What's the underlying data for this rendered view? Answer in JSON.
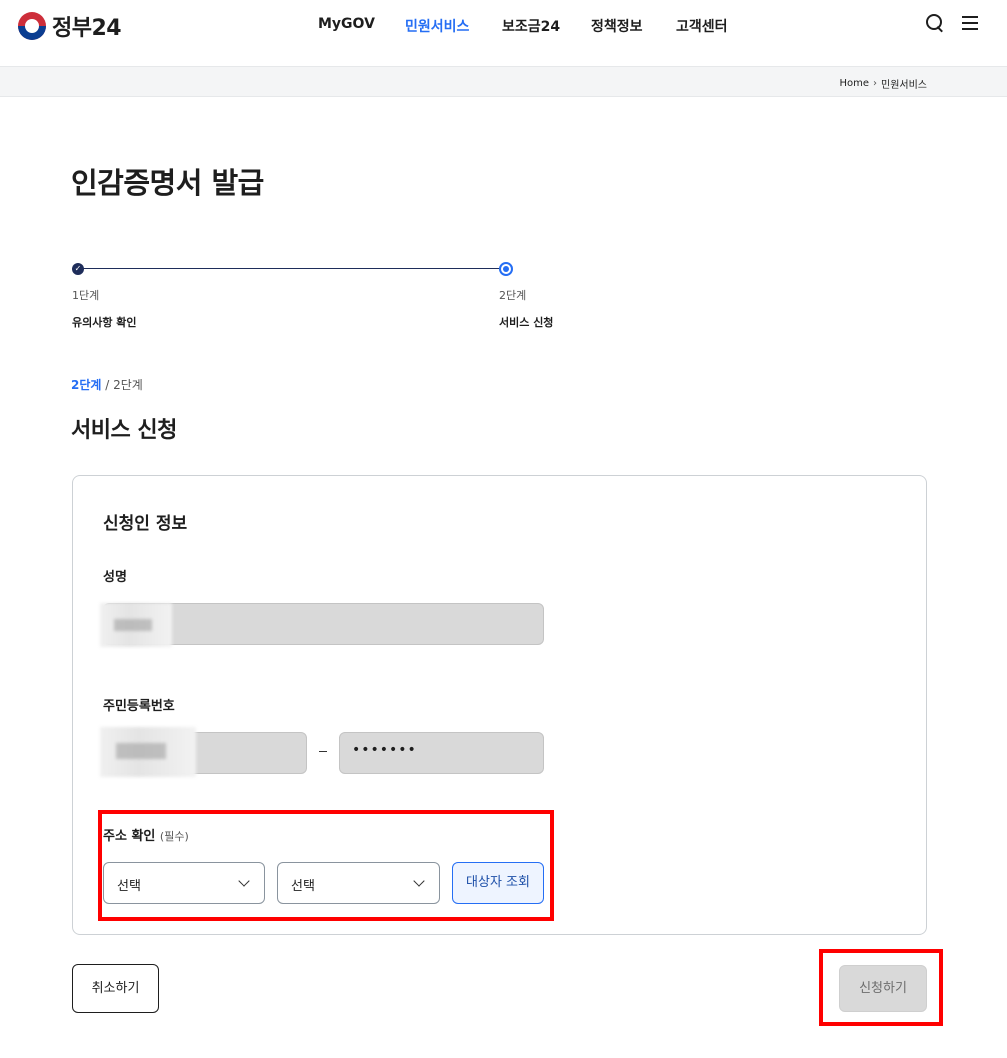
{
  "header": {
    "logo_text": "정부24",
    "nav": [
      {
        "label": "MyGOV",
        "active": false
      },
      {
        "label": "민원서비스",
        "active": true
      },
      {
        "label": "보조금24",
        "active": false
      },
      {
        "label": "정책정보",
        "active": false
      },
      {
        "label": "고객센터",
        "active": false
      }
    ],
    "icons": [
      "search-icon",
      "menu-icon"
    ]
  },
  "breadcrumb": {
    "home": "Home",
    "current": "민원서비스"
  },
  "page_title": "인감증명서 발급",
  "stepper": {
    "steps": [
      {
        "num": "1단계",
        "label": "유의사항 확인",
        "status": "done"
      },
      {
        "num": "2단계",
        "label": "서비스 신청",
        "status": "current"
      }
    ]
  },
  "progress": {
    "current": "2단계",
    "separator": " / ",
    "total": "2단계"
  },
  "section_title": "서비스 신청",
  "form": {
    "card_title": "신청인 정보",
    "name_label": "성명",
    "rrn_label": "주민등록번호",
    "rrn_separator": "–",
    "rrn_back_masked": "•••••••",
    "address_label": "주소 확인",
    "address_hint": "(필수)",
    "select1": "선택",
    "select2": "선택",
    "lookup_button": "대상자 조회"
  },
  "actions": {
    "cancel": "취소하기",
    "submit": "신청하기"
  },
  "colors": {
    "accent": "#256ef4",
    "navy": "#1e2d5a",
    "highlight": "#ff0000",
    "disabled_bg": "#d9d9d9"
  }
}
